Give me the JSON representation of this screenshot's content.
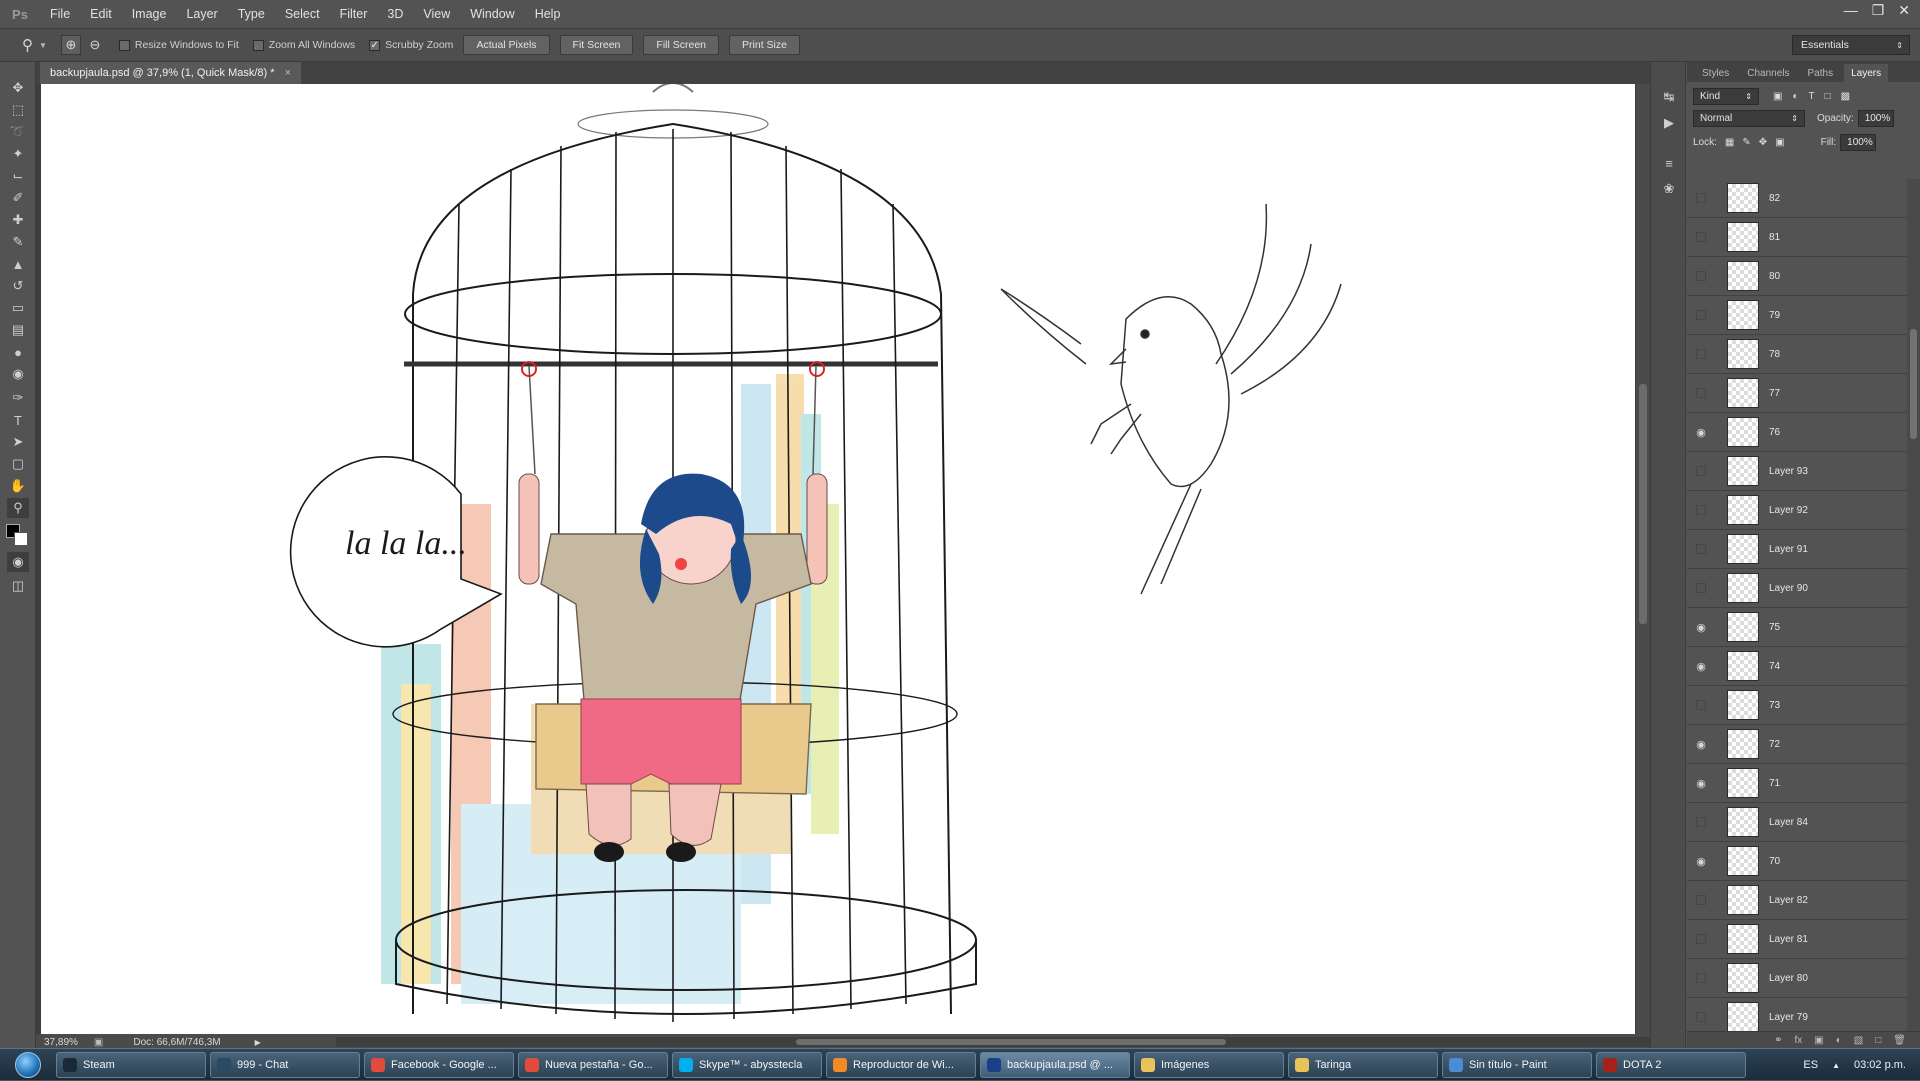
{
  "app": {
    "logo": "Ps",
    "menu": [
      "File",
      "Edit",
      "Image",
      "Layer",
      "Type",
      "Select",
      "Filter",
      "3D",
      "View",
      "Window",
      "Help"
    ]
  },
  "options": {
    "resize_windows": "Resize Windows to Fit",
    "zoom_all": "Zoom All Windows",
    "scrubby_zoom": "Scrubby Zoom",
    "actual_pixels": "Actual Pixels",
    "fit_screen": "Fit Screen",
    "fill_screen": "Fill Screen",
    "print_size": "Print Size",
    "workspace": "Essentials"
  },
  "document": {
    "tab_title": "backupjaula.psd @ 37,9% (1, Quick Mask/8) *",
    "zoom": "37,89%",
    "doc_size": "Doc: 66,6M/746,3M",
    "speech_text": "la la la..."
  },
  "layers_panel": {
    "tabs": [
      "Styles",
      "Channels",
      "Paths",
      "Layers"
    ],
    "kind_label": "Kind",
    "blend_mode": "Normal",
    "opacity_label": "Opacity:",
    "opacity_value": "100%",
    "lock_label": "Lock:",
    "fill_label": "Fill:",
    "fill_value": "100%",
    "layers": [
      {
        "name": "82",
        "visible": false
      },
      {
        "name": "81",
        "visible": false
      },
      {
        "name": "80",
        "visible": false
      },
      {
        "name": "79",
        "visible": false
      },
      {
        "name": "78",
        "visible": false
      },
      {
        "name": "77",
        "visible": false
      },
      {
        "name": "76",
        "visible": true
      },
      {
        "name": "Layer 93",
        "visible": false
      },
      {
        "name": "Layer 92",
        "visible": false
      },
      {
        "name": "Layer 91",
        "visible": false
      },
      {
        "name": "Layer 90",
        "visible": false
      },
      {
        "name": "75",
        "visible": true
      },
      {
        "name": "74",
        "visible": true
      },
      {
        "name": "73",
        "visible": false
      },
      {
        "name": "72",
        "visible": true
      },
      {
        "name": "71",
        "visible": true
      },
      {
        "name": "Layer 84",
        "visible": false
      },
      {
        "name": "70",
        "visible": true
      },
      {
        "name": "Layer 82",
        "visible": false
      },
      {
        "name": "Layer 81",
        "visible": false
      },
      {
        "name": "Layer 80",
        "visible": false
      },
      {
        "name": "Layer 79",
        "visible": false
      }
    ]
  },
  "taskbar": {
    "items": [
      {
        "label": "Steam",
        "color": "#1b2838"
      },
      {
        "label": "999 - Chat",
        "color": "#2a4a66"
      },
      {
        "label": "Facebook - Google ...",
        "color": "#e14b3b"
      },
      {
        "label": "Nueva pestaña - Go...",
        "color": "#e14b3b"
      },
      {
        "label": "Skype™ - abysstecla",
        "color": "#00aff0"
      },
      {
        "label": "Reproductor de Wi...",
        "color": "#f08a24"
      },
      {
        "label": "backupjaula.psd @ ...",
        "color": "#1c3f8a"
      },
      {
        "label": "Imágenes",
        "color": "#e8c35a"
      },
      {
        "label": "Taringa",
        "color": "#e8c35a"
      },
      {
        "label": "Sin título - Paint",
        "color": "#4c8bd6"
      },
      {
        "label": "DOTA 2",
        "color": "#a8201a"
      }
    ],
    "lang": "ES",
    "time": "03:02 p.m."
  }
}
